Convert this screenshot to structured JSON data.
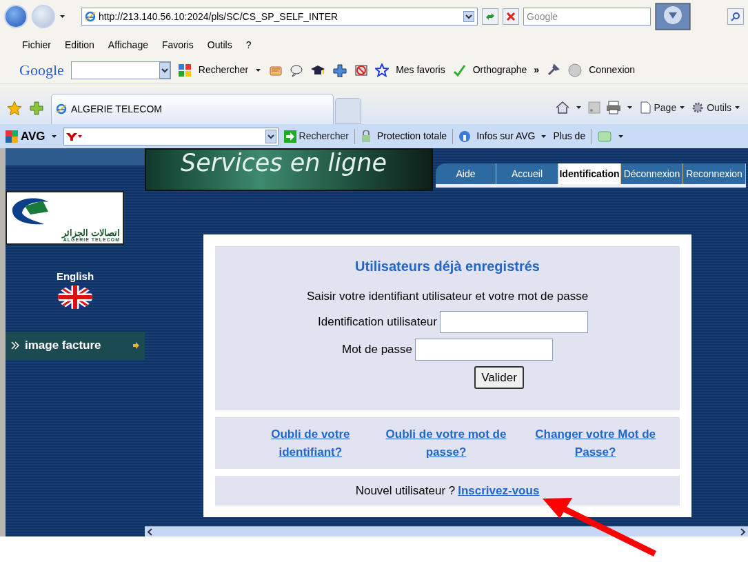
{
  "browser": {
    "address": "http://213.140.56.10:2024/pls/SC/CS_SP_SELF_INTER",
    "search_placeholder": "Google",
    "menu": [
      "Fichier",
      "Edition",
      "Affichage",
      "Favoris",
      "Outils",
      "?"
    ],
    "google_toolbar": {
      "logo": "Google",
      "search_button": "Rechercher",
      "favorites": "Mes favoris",
      "spelling": "Orthographe",
      "more": "»",
      "login": "Connexion"
    },
    "tab": {
      "title": "ALGERIE TELECOM"
    },
    "command_bar": {
      "page": "Page",
      "tools": "Outils"
    },
    "avg_toolbar": {
      "logo": "AVG",
      "search_button": "Rechercher",
      "protection": "Protection totale",
      "info": "Infos sur AVG",
      "more": "Plus de"
    }
  },
  "page": {
    "banner_title": "Services en ligne",
    "tabs": [
      {
        "label": "Aide",
        "selected": false
      },
      {
        "label": "Accueil",
        "selected": false
      },
      {
        "label": "Identification",
        "selected": true
      },
      {
        "label": "Déconnexion",
        "selected": false
      },
      {
        "label": "Reconnexion",
        "selected": false
      }
    ],
    "sidebar": {
      "logo_arabic": "اتصالات الجزائر",
      "logo_latin": "ALGERIE TELECOM",
      "language": "English",
      "menu": [
        {
          "label": "image facture"
        }
      ]
    },
    "login": {
      "title": "Utilisateurs déjà enregistrés",
      "instruction": "Saisir votre identifiant utilisateur et votre mot de passe",
      "fields": [
        {
          "label": "Identification utilisateur"
        },
        {
          "label": "Mot de passe"
        }
      ],
      "submit": "Valider",
      "links": [
        "Oubli de votre identifiant?",
        "Oubli de votre mot de passe?",
        "Changer votre Mot de Passe?"
      ],
      "new_user": "Nouvel utilisateur ?",
      "register": "Inscrivez-vous"
    }
  }
}
